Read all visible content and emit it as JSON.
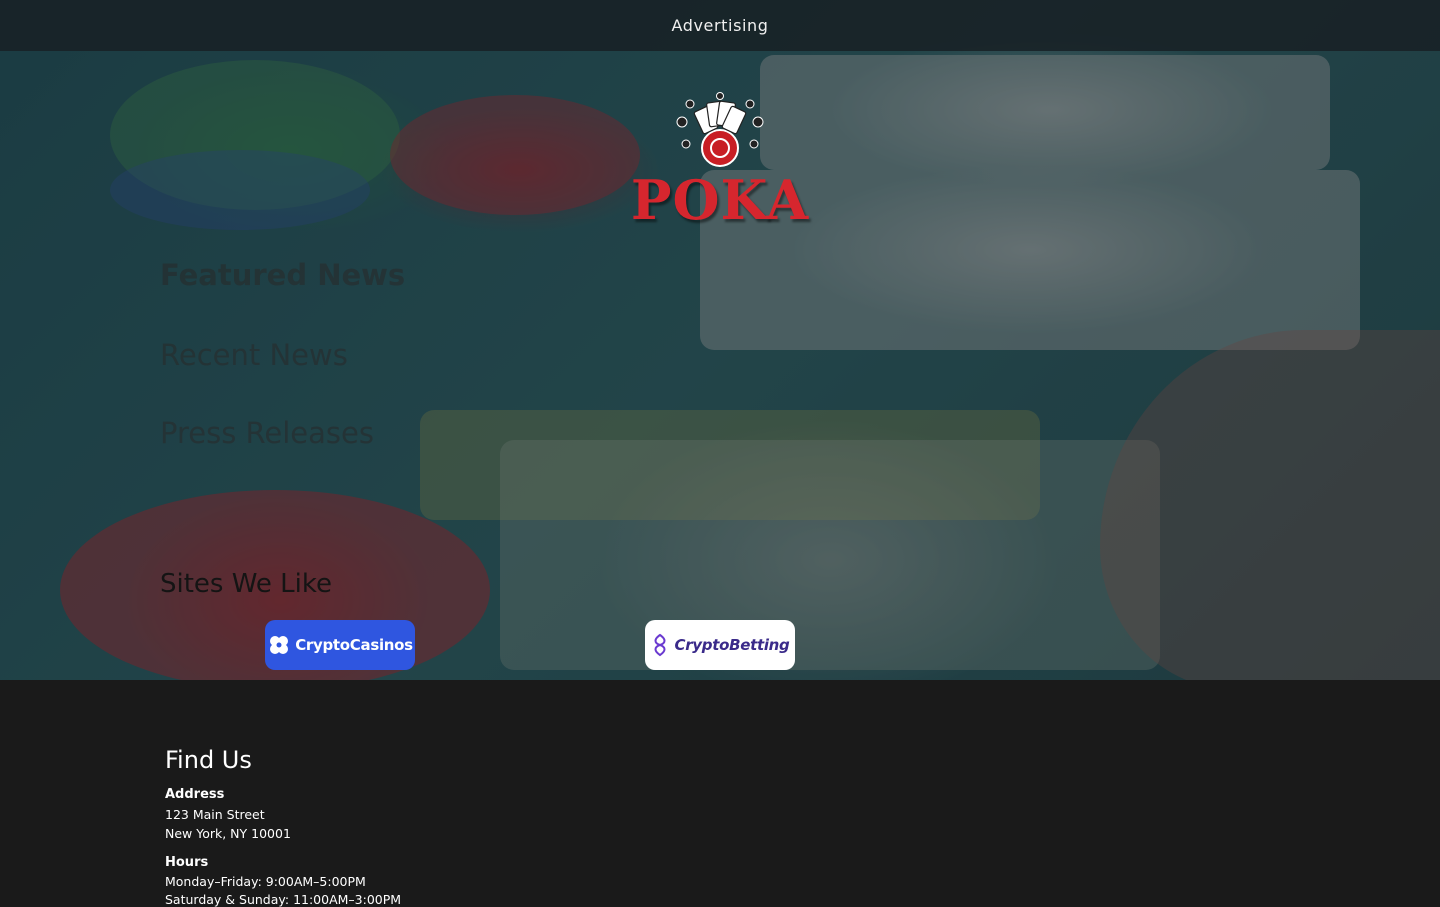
{
  "ad_bar": {
    "label": "Advertising"
  },
  "brand": {
    "name": "POKA"
  },
  "nav": [
    {
      "label": "Featured News"
    },
    {
      "label": "Recent News"
    },
    {
      "label": "Press Releases"
    }
  ],
  "sites": {
    "title": "Sites We Like",
    "items": [
      {
        "label": "CryptoCasinos",
        "icon": "clover-icon"
      },
      {
        "label": "CryptoBetting",
        "icon": "crypto-betting-icon"
      }
    ]
  },
  "footer": {
    "title": "Find Us",
    "address_label": "Address",
    "address_lines": [
      "123 Main Street",
      "New York, NY 10001"
    ],
    "hours_label": "Hours",
    "hours_lines": [
      "Monday–Friday: 9:00AM–5:00PM",
      "Saturday & Sunday: 11:00AM–3:00PM"
    ]
  },
  "colors": {
    "brand_red": "#d6262e",
    "footer_bg": "#1a1a1a",
    "casinos_blue": "#2f56e0",
    "betting_purple": "#3a2a8a"
  }
}
